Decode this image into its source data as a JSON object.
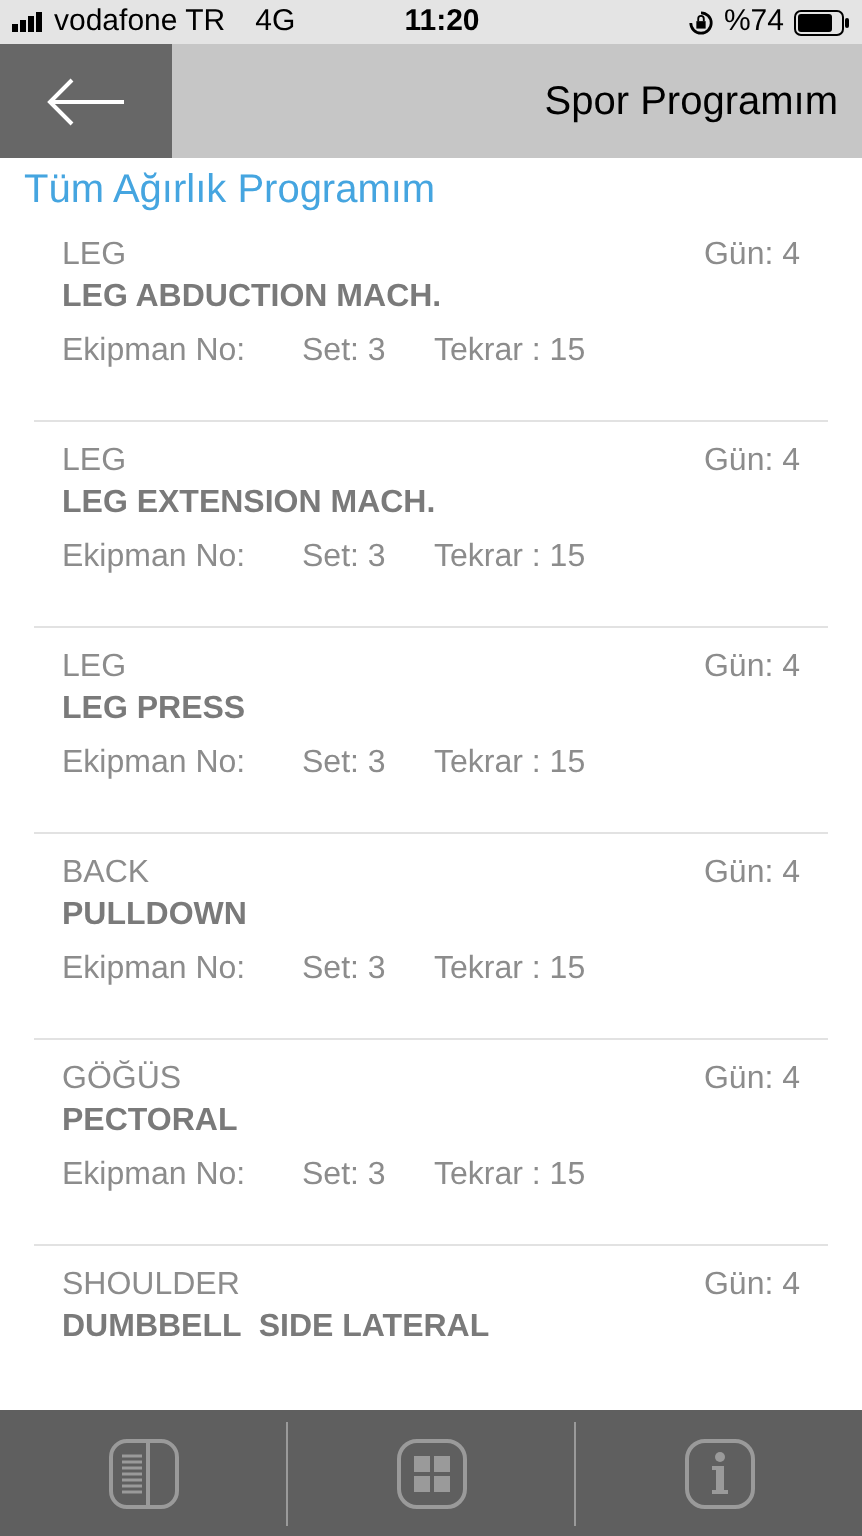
{
  "status_bar": {
    "carrier": "vodafone TR",
    "network": "4G",
    "time": "11:20",
    "battery": "%74"
  },
  "header": {
    "title": "Spor Programım"
  },
  "section_title": "Tüm Ağırlık Programım",
  "exercises": [
    {
      "category": "LEG",
      "day": "Gün: 4",
      "name": "LEG ABDUCTION MACH.",
      "equipment": "Ekipman No:",
      "sets": "Set: 3",
      "reps": "Tekrar : 15"
    },
    {
      "category": "LEG",
      "day": "Gün: 4",
      "name": "LEG EXTENSION MACH.",
      "equipment": "Ekipman No:",
      "sets": "Set: 3",
      "reps": "Tekrar : 15"
    },
    {
      "category": "LEG",
      "day": "Gün: 4",
      "name": "LEG PRESS",
      "equipment": "Ekipman No:",
      "sets": "Set: 3",
      "reps": "Tekrar : 15"
    },
    {
      "category": "BACK",
      "day": "Gün: 4",
      "name": "PULLDOWN",
      "equipment": "Ekipman No:",
      "sets": "Set: 3",
      "reps": "Tekrar : 15"
    },
    {
      "category": "GÖĞÜS",
      "day": "Gün: 4",
      "name": "PECTORAL",
      "equipment": "Ekipman No:",
      "sets": "Set: 3",
      "reps": "Tekrar : 15"
    },
    {
      "category": "SHOULDER",
      "day": "Gün: 4",
      "name": "DUMBBELL  SIDE LATERAL"
    }
  ]
}
